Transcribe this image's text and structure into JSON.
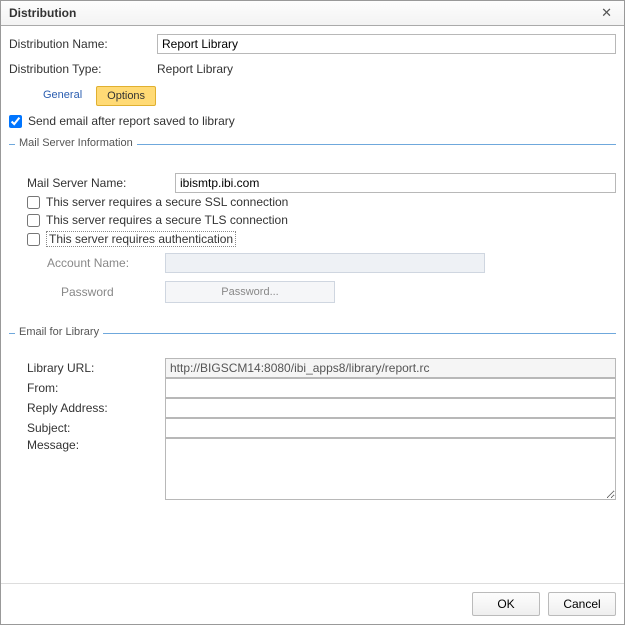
{
  "window": {
    "title": "Distribution"
  },
  "fields": {
    "dist_name_label": "Distribution Name:",
    "dist_name_value": "Report Library",
    "dist_type_label": "Distribution Type:",
    "dist_type_value": "Report Library"
  },
  "tabs": {
    "general": "General",
    "options": "Options"
  },
  "options": {
    "send_email_label": "Send email after report saved to library",
    "send_email_checked": true
  },
  "mail_server": {
    "legend": "Mail Server Information",
    "name_label": "Mail Server Name:",
    "name_value": "ibismtp.ibi.com",
    "ssl_label": "This server requires a secure SSL connection",
    "tls_label": "This server requires a secure TLS connection",
    "auth_label": "This server requires authentication",
    "account_label": "Account Name:",
    "password_label": "Password",
    "password_button": "Password..."
  },
  "email_lib": {
    "legend": "Email for Library",
    "url_label": "Library URL:",
    "url_value": "http://BIGSCM14:8080/ibi_apps8/library/report.rc",
    "from_label": "From:",
    "from_value": "",
    "reply_label": "Reply Address:",
    "reply_value": "",
    "subject_label": "Subject:",
    "subject_value": "",
    "message_label": "Message:",
    "message_value": ""
  },
  "buttons": {
    "ok": "OK",
    "cancel": "Cancel"
  }
}
